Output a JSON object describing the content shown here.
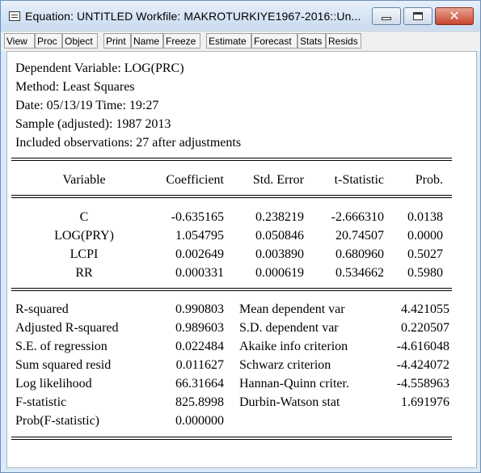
{
  "window": {
    "title": "Equation: UNTITLED   Workfile: MAKROTURKIYE1967-2016::Un..."
  },
  "toolbar": {
    "buttons": [
      "View",
      "Proc",
      "Object",
      "Print",
      "Name",
      "Freeze",
      "Estimate",
      "Forecast",
      "Stats",
      "Resids"
    ]
  },
  "header": {
    "dependent": "Dependent Variable: LOG(PRC)",
    "method": "Method: Least Squares",
    "date": "Date: 05/13/19   Time: 19:27",
    "sample": "Sample (adjusted): 1987 2013",
    "observations": "Included observations: 27 after adjustments"
  },
  "coef_table": {
    "columns": [
      "Variable",
      "Coefficient",
      "Std. Error",
      "t-Statistic",
      "Prob."
    ],
    "rows": [
      [
        "C",
        "-0.635165",
        "0.238219",
        "-2.666310",
        "0.0138"
      ],
      [
        "LOG(PRY)",
        "1.054795",
        "0.050846",
        "20.74507",
        "0.0000"
      ],
      [
        "LCPI",
        "0.002649",
        "0.003890",
        "0.680960",
        "0.5027"
      ],
      [
        "RR",
        "0.000331",
        "0.000619",
        "0.534662",
        "0.5980"
      ]
    ]
  },
  "stats": [
    [
      "R-squared",
      "0.990803",
      "Mean dependent var",
      "4.421055"
    ],
    [
      "Adjusted R-squared",
      "0.989603",
      "S.D. dependent var",
      "0.220507"
    ],
    [
      "S.E. of regression",
      "0.022484",
      "Akaike info criterion",
      "-4.616048"
    ],
    [
      "Sum squared resid",
      "0.011627",
      "Schwarz criterion",
      "-4.424072"
    ],
    [
      "Log likelihood",
      "66.31664",
      "Hannan-Quinn criter.",
      "-4.558963"
    ],
    [
      "F-statistic",
      "825.8998",
      "Durbin-Watson stat",
      "1.691976"
    ],
    [
      "Prob(F-statistic)",
      "0.000000",
      "",
      ""
    ]
  ]
}
